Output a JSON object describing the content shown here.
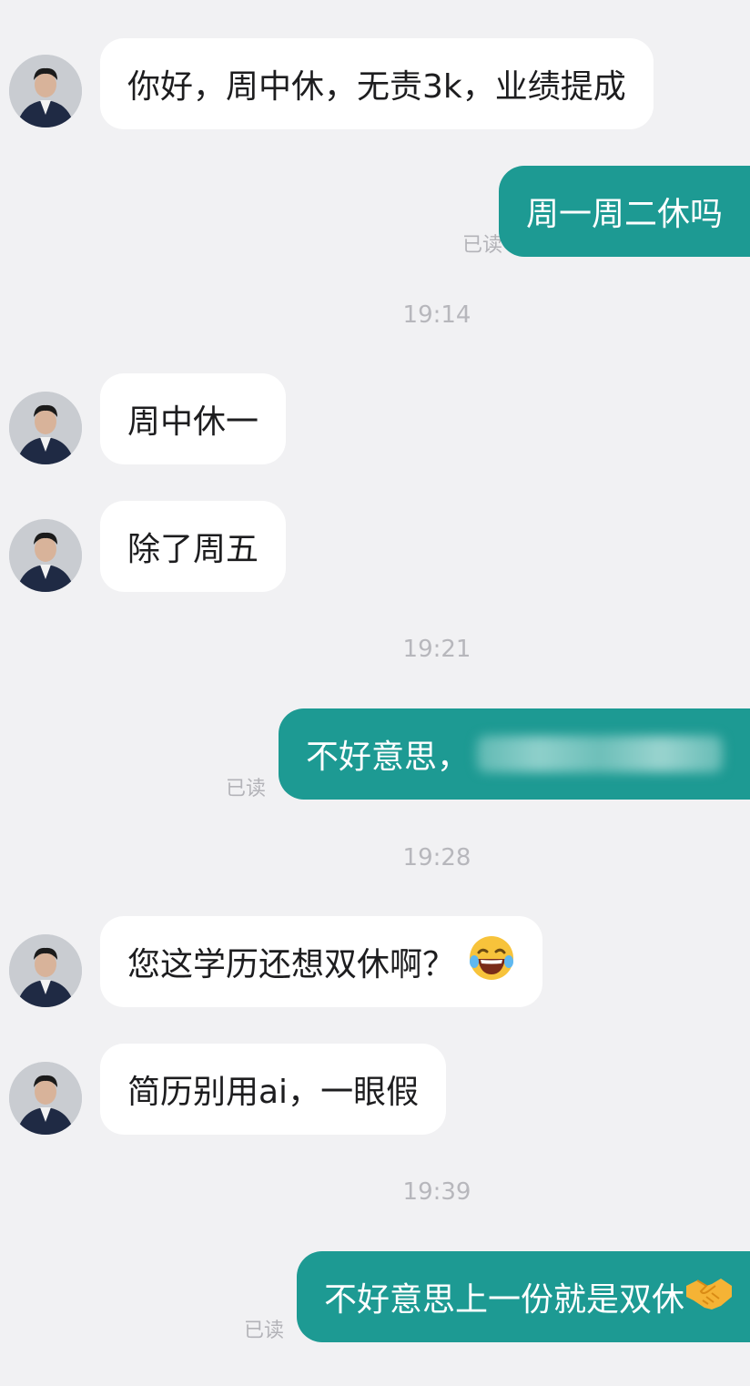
{
  "conversation": {
    "messages": [
      {
        "side": "in",
        "text": "你好，周中休，无责3k，业绩提成"
      },
      {
        "side": "out",
        "text": "周一周二休吗",
        "status": "已读"
      },
      {
        "side": "time",
        "text": "19:14"
      },
      {
        "side": "in",
        "text": "周中休一"
      },
      {
        "side": "in",
        "text": "除了周五"
      },
      {
        "side": "time",
        "text": "19:21"
      },
      {
        "side": "out",
        "text": "不好意思，",
        "status": "已读",
        "redacted": true
      },
      {
        "side": "time",
        "text": "19:28"
      },
      {
        "side": "in",
        "text": "您这学历还想双休啊？",
        "emoji": "laughing-with-tears-emoji"
      },
      {
        "side": "in",
        "text": "简历别用ai，一眼假"
      },
      {
        "side": "time",
        "text": "19:39"
      },
      {
        "side": "out",
        "text": "不好意思上一份就是双休",
        "status": "已读",
        "emoji": "handshake-emoji"
      }
    ]
  },
  "colors": {
    "background": "#f1f1f3",
    "incoming_bubble": "#ffffff",
    "outgoing_bubble": "#1d9a93",
    "timestamp": "#b7b7bc",
    "read_status": "#b3b3b8"
  }
}
